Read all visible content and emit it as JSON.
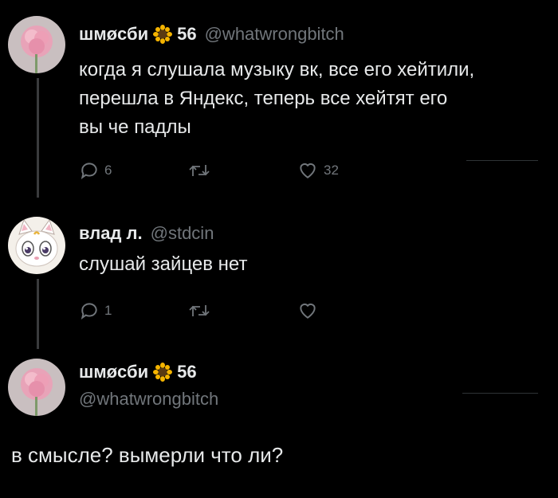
{
  "tweets": [
    {
      "author": "шмøсби",
      "badge_count": "56",
      "handle": "@whatwrongbitch",
      "lines": [
        "когда я слушала музыку вк, все его хейтили,",
        "перешла в Яндекс, теперь все хейтят его",
        "вы че падлы"
      ],
      "reply_count": "6",
      "retweet_count": "",
      "like_count": "32"
    },
    {
      "author": "влад л.",
      "handle": "@stdcin",
      "lines": [
        "слушай зайцев нет"
      ],
      "reply_count": "1",
      "retweet_count": "",
      "like_count": ""
    },
    {
      "author": "шмøсби",
      "badge_count": "56",
      "handle": "@whatwrongbitch",
      "lines": [
        "в смысле? вымерли что ли?"
      ]
    }
  ],
  "colors": {
    "background": "#000000",
    "text": "#e7e9ea",
    "muted": "#71767b",
    "thread_line": "#3a3b3d",
    "sunflower": "#f5b400"
  },
  "icons": [
    "reply-icon",
    "retweet-icon",
    "like-icon",
    "sunflower-icon"
  ]
}
